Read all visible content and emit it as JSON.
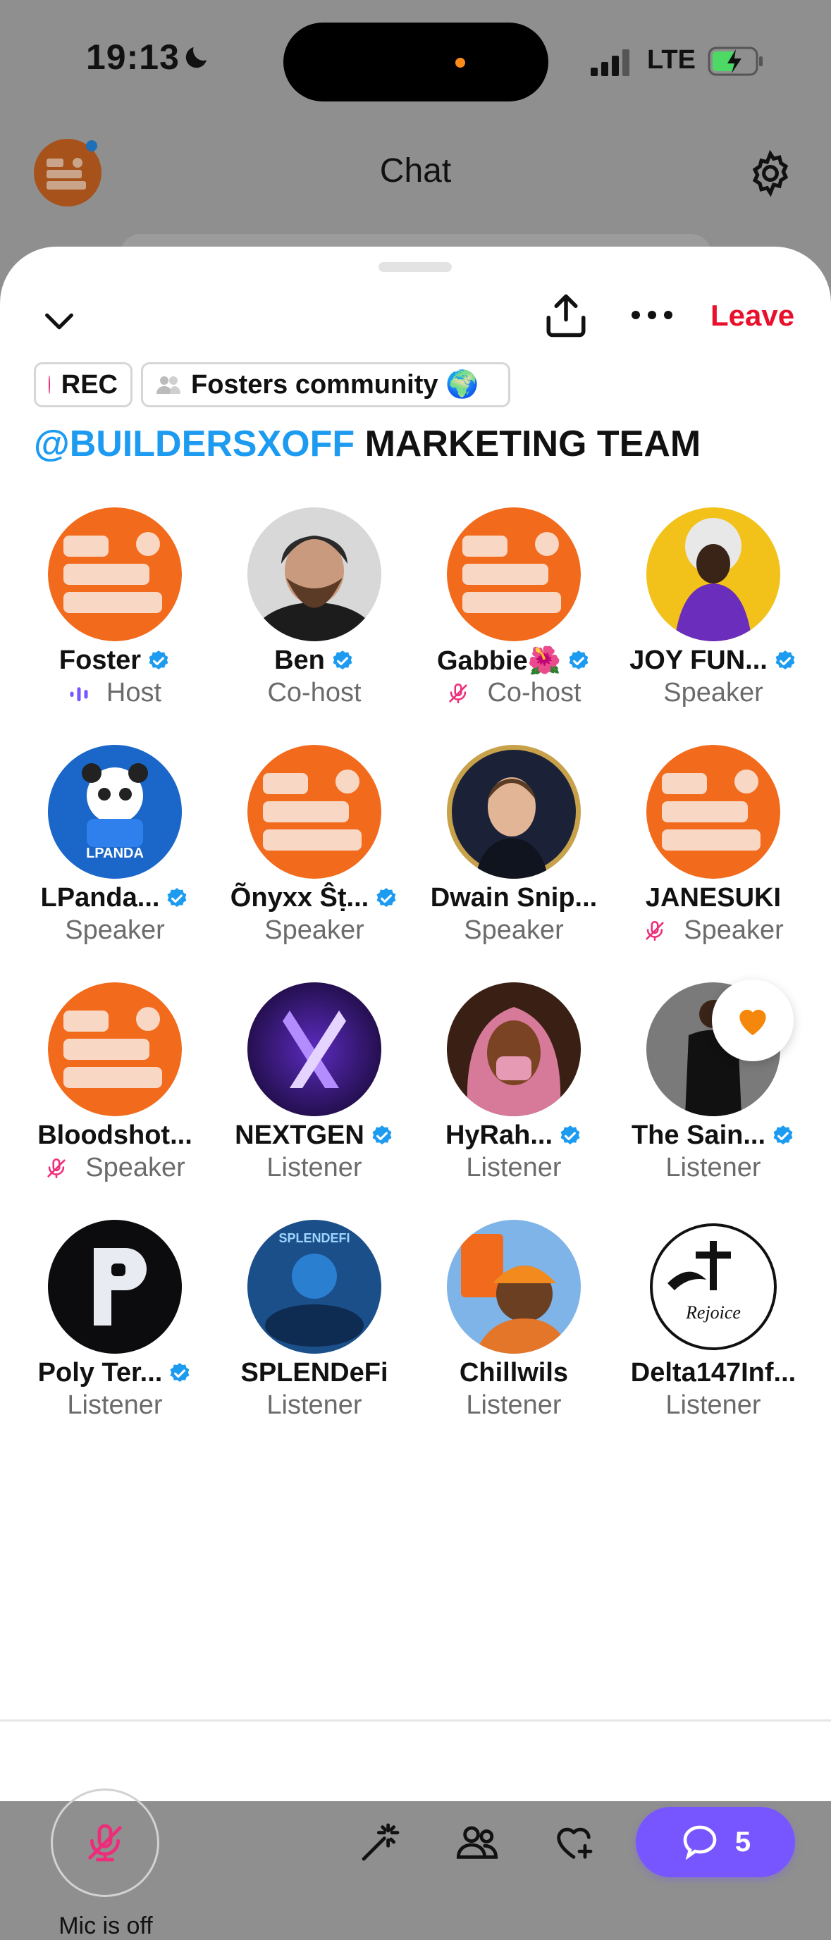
{
  "status_bar": {
    "time": "19:13",
    "network": "LTE"
  },
  "header": {
    "title": "Chat"
  },
  "space": {
    "leave_label": "Leave",
    "rec_label": "REC",
    "community_label": "Fosters community 🌍",
    "title_handle": "@BUILDERSXOFF",
    "title_rest": " MARKETING TEAM"
  },
  "participants": [
    {
      "name": "Foster",
      "role": "Host",
      "verified": true,
      "role_icon": "speaking-bars-icon",
      "avatar": "builders-logo"
    },
    {
      "name": "Ben",
      "role": "Co-host",
      "verified": true,
      "role_icon": "",
      "avatar": "bearded-man-photo"
    },
    {
      "name": "Gabbie🌺",
      "role": "Co-host",
      "verified": true,
      "role_icon": "mic-off-icon",
      "avatar": "builders-logo"
    },
    {
      "name": "JOY FUN...",
      "role": "Speaker",
      "verified": true,
      "role_icon": "",
      "avatar": "purple-suit-art"
    },
    {
      "name": "LPanda...",
      "role": "Speaker",
      "verified": true,
      "role_icon": "",
      "avatar": "lpanda-token"
    },
    {
      "name": "Õnyxx Ŝṭ...",
      "role": "Speaker",
      "verified": true,
      "role_icon": "",
      "avatar": "builders-logo"
    },
    {
      "name": "Dwain Snip...",
      "role": "Speaker",
      "verified": false,
      "role_icon": "",
      "avatar": "suit-man-photo"
    },
    {
      "name": "JANESUKI",
      "role": "Speaker",
      "verified": false,
      "role_icon": "mic-off-icon",
      "avatar": "builders-logo"
    },
    {
      "name": "Bloodshot...",
      "role": "Speaker",
      "verified": false,
      "role_icon": "mic-off-icon",
      "avatar": "builders-logo"
    },
    {
      "name": "NEXTGEN",
      "role": "Listener",
      "verified": true,
      "role_icon": "",
      "avatar": "nextgen-x-logo"
    },
    {
      "name": "HyRah...",
      "role": "Listener",
      "verified": true,
      "role_icon": "",
      "avatar": "pink-hijab-art"
    },
    {
      "name": "The Sain...",
      "role": "Listener",
      "verified": true,
      "role_icon": "",
      "avatar": "black-hoodie-photo"
    },
    {
      "name": "Poly Ter...",
      "role": "Listener",
      "verified": true,
      "role_icon": "",
      "avatar": "poly-p-logo"
    },
    {
      "name": "SPLENDeFi",
      "role": "Listener",
      "verified": false,
      "role_icon": "",
      "avatar": "splendefi-art"
    },
    {
      "name": "Chillwils",
      "role": "Listener",
      "verified": false,
      "role_icon": "",
      "avatar": "builders-worker-art"
    },
    {
      "name": "Delta147Inf...",
      "role": "Listener",
      "verified": false,
      "role_icon": "",
      "avatar": "rejoice-gods-gift-logo"
    }
  ],
  "bottom_bar": {
    "mic_label": "Mic is off",
    "chat_count": "5"
  },
  "colors": {
    "accent": "#7856ff",
    "leave": "#e8102a",
    "verified": "#1d9bf0",
    "builders_orange": "#f26b1d",
    "mute_pink": "#ee2d7a"
  }
}
